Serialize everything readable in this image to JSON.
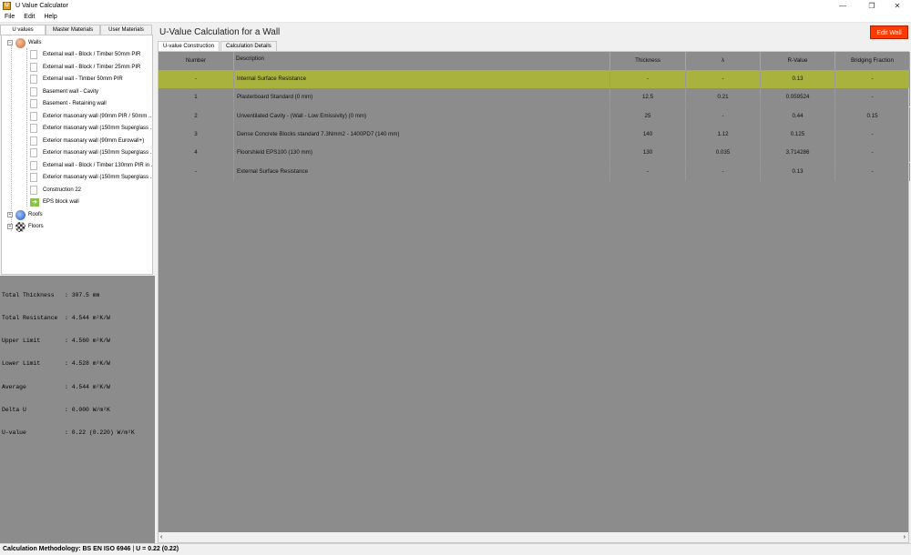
{
  "window": {
    "title": "U Value Calculator",
    "minimize": "—",
    "maximize": "❐",
    "close": "✕"
  },
  "menu": [
    "File",
    "Edit",
    "Help"
  ],
  "left_tabs": [
    "U values",
    "Master Materials",
    "User Materials"
  ],
  "tree": {
    "walls_label": "Walls",
    "wall_items": [
      "External wall - Block / Timber 50mm PIR",
      "External wall - Block / Timber 25mm PIR",
      "External wall - Timber 50mm PIR",
      "Basement wall - Cavity",
      "Basement - Retaining wall",
      "Exterior masonary wall (90mm PIR / 50mm ...",
      "Exterior masonary wall (150mm Superglass ...",
      "Exterior masonary wall (90mm Eurowall+)",
      "Exterior masonary wall (150mm Superglass ...",
      "External wall - Block / Timber 130mm PIR in ...",
      "Exterior masonary wall (150mm Superglass ...",
      "Construction 22",
      "EPS block wall"
    ],
    "roofs_label": "Roofs",
    "floors_label": "Floors",
    "expanded_symbol": "−",
    "collapsed_symbol": "+"
  },
  "summary": [
    "Total Thickness   : 307.5 mm",
    "Total Resistance  : 4.544 m²K/W",
    "Upper Limit       : 4.560 m²K/W",
    "Lower Limit       : 4.528 m²K/W",
    "Average           : 4.544 m²K/W",
    "Delta U           : 0.000 W/m²K",
    "U-value           : 0.22 (0.220) W/m²K"
  ],
  "main": {
    "title": "U-Value Calculation for a Wall",
    "edit_button": "Edit Wall",
    "tabs": [
      "U-value Construction",
      "Calculation Details"
    ]
  },
  "table": {
    "headers": [
      "Number",
      "Description",
      "Thickness",
      "λ",
      "R-Value",
      "Bridging Fraction"
    ],
    "rows": [
      [
        "-",
        "Internal Surface Resistance",
        "-",
        "-",
        "0.13",
        "-"
      ],
      [
        "1",
        "Plasterboard Standard (0 mm)",
        "12.5",
        "0.21",
        "0.059524",
        "-"
      ],
      [
        "2",
        "Unventilated Cavity - (Wall - Low Emissivity) (0 mm)",
        "25",
        "-",
        "0.44",
        "0.15"
      ],
      [
        "3",
        "Dense Concrete Blocks standard 7.3Nmm2 - 1400PD7 (140 mm)",
        "140",
        "1.12",
        "0.125",
        "-"
      ],
      [
        "4",
        "Floorshield EPS100 (130 mm)",
        "130",
        "0.035",
        "3.714286",
        "-"
      ],
      [
        "-",
        "External Surface Resistance",
        "-",
        "-",
        "0.13",
        "-"
      ]
    ],
    "selected_row": 0
  },
  "scroll": {
    "left": "‹",
    "right": "›"
  },
  "status": {
    "methodology": "Calculation Methodology: BS EN ISO 6946",
    "separator": "|",
    "uvalue": "U = 0.22 (0.22)"
  },
  "colors": {
    "edit_button": "#ff3a00",
    "selected_row": "#a8b23c",
    "grid_bg": "#8c8c8c"
  },
  "icons": {
    "walls": "wall-icon",
    "roofs": "house-icon",
    "floors": "floor-icon",
    "selected_wall": "arrow-right-icon"
  }
}
